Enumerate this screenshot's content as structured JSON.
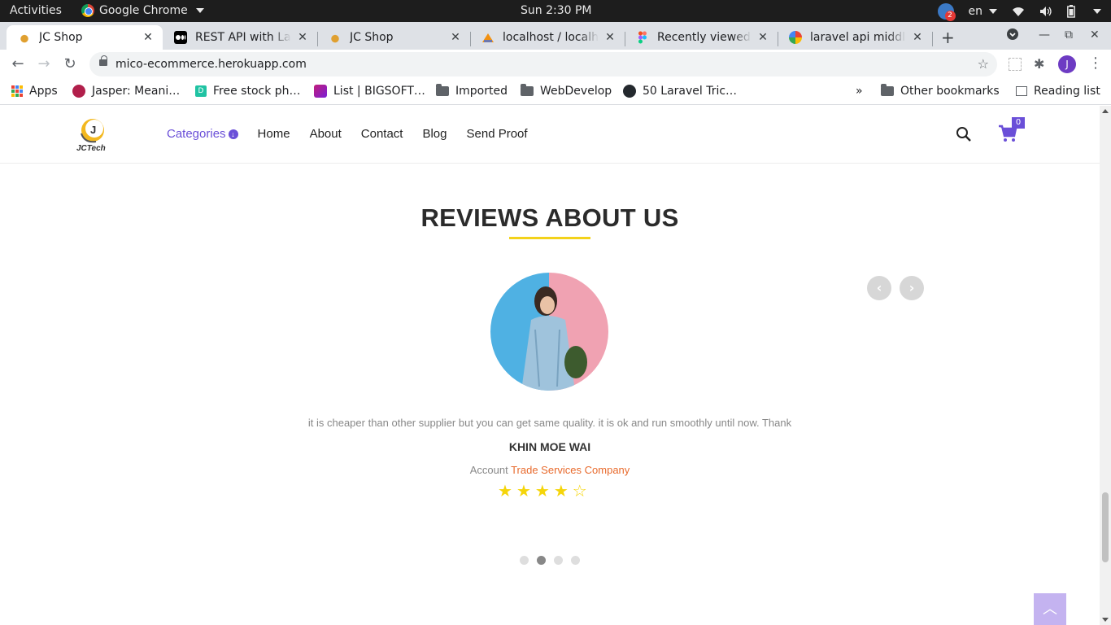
{
  "system_bar": {
    "activities": "Activities",
    "app_name": "Google Chrome",
    "clock": "Sun  2:30 PM",
    "notification_count": "2",
    "language": "en"
  },
  "tabs": [
    {
      "title": "JC Shop",
      "active": true,
      "icon": "jc-shop-favicon"
    },
    {
      "title": "REST API with Laravel",
      "active": false,
      "icon": "medium-favicon"
    },
    {
      "title": "JC Shop",
      "active": false,
      "icon": "jc-shop-favicon"
    },
    {
      "title": "localhost / localhost",
      "active": false,
      "icon": "phpmyadmin-favicon"
    },
    {
      "title": "Recently viewed – Figma",
      "active": false,
      "icon": "figma-favicon"
    },
    {
      "title": "laravel api middleware",
      "active": false,
      "icon": "google-favicon"
    }
  ],
  "address_bar": {
    "url": "mico-ecommerce.herokuapp.com"
  },
  "profile_initial": "J",
  "bookmarks": {
    "apps": "Apps",
    "items": [
      "Jasper: Meani…",
      "Free stock ph…",
      "List | BIGSOFT…",
      "Imported",
      "WebDevelop",
      "50 Laravel Tric…"
    ],
    "overflow": "»",
    "other": "Other bookmarks",
    "reading_list": "Reading list"
  },
  "site": {
    "logo_text": "JCTech",
    "logo_letter": "J",
    "nav": [
      "Categories",
      "Home",
      "About",
      "Contact",
      "Blog",
      "Send Proof"
    ],
    "cart_count": "0"
  },
  "reviews": {
    "heading": "REVIEWS ABOUT US",
    "quote": "it is cheaper than other supplier but you can get same quality. it is ok and run smoothly until now. Thank",
    "name": "KHIN MOE WAI",
    "role_prefix": "Account",
    "company": "Trade Services Company",
    "rating": 4,
    "rating_max": 5,
    "star_filled": "★",
    "star_empty": "☆",
    "slide_count": 4,
    "active_slide": 2
  },
  "colors": {
    "accent": "#6a4fd8",
    "underline": "#f3d21b",
    "company": "#e86a2c",
    "star": "#f5d50a",
    "to_top": "#c4b3f0"
  }
}
